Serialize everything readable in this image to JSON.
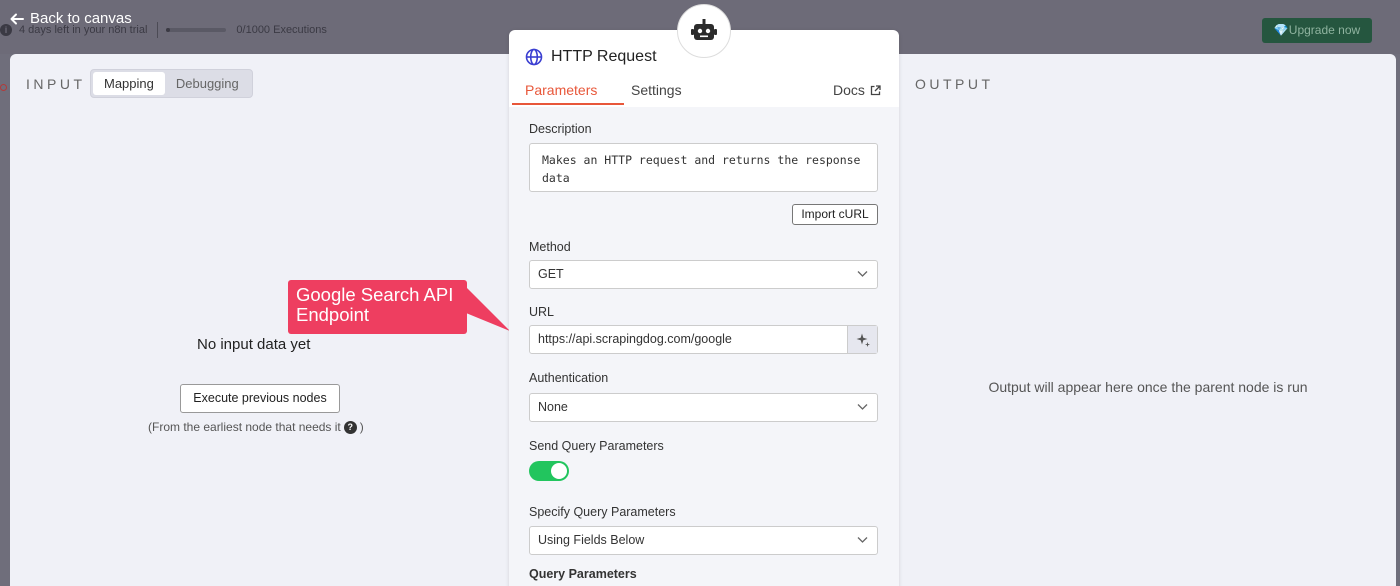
{
  "topbar": {
    "back_label": "Back to canvas",
    "trial_text": "4 days left in your n8n trial",
    "executions_text": "0/1000 Executions",
    "upgrade_label": "Upgrade now"
  },
  "input_panel": {
    "title": "INPUT",
    "tabs": [
      {
        "label": "Mapping",
        "active": true
      },
      {
        "label": "Debugging",
        "active": false
      }
    ],
    "empty_message": "No input data yet",
    "execute_label": "Execute previous nodes",
    "execute_hint": "(From the earliest node that needs it",
    "execute_hint_close": ")"
  },
  "output_panel": {
    "title": "OUTPUT",
    "empty_message": "Output will appear here once the parent node is run"
  },
  "annotation": {
    "text": "Google Search API Endpoint",
    "color": "#ee3e60"
  },
  "node": {
    "title": "HTTP Request",
    "icon": "globe-icon",
    "tabs": {
      "parameters": "Parameters",
      "settings": "Settings",
      "docs": "Docs"
    },
    "accent_color": "#e8573a",
    "description_label": "Description",
    "description_value": "Makes an HTTP request and returns the response data",
    "import_curl_label": "Import cURL",
    "method_label": "Method",
    "method_value": "GET",
    "url_label": "URL",
    "url_value": "https://api.scrapingdog.com/google",
    "auth_label": "Authentication",
    "auth_value": "None",
    "send_query_label": "Send Query Parameters",
    "send_query_enabled": true,
    "specify_query_label": "Specify Query Parameters",
    "specify_query_value": "Using Fields Below",
    "query_params_label": "Query Parameters"
  }
}
